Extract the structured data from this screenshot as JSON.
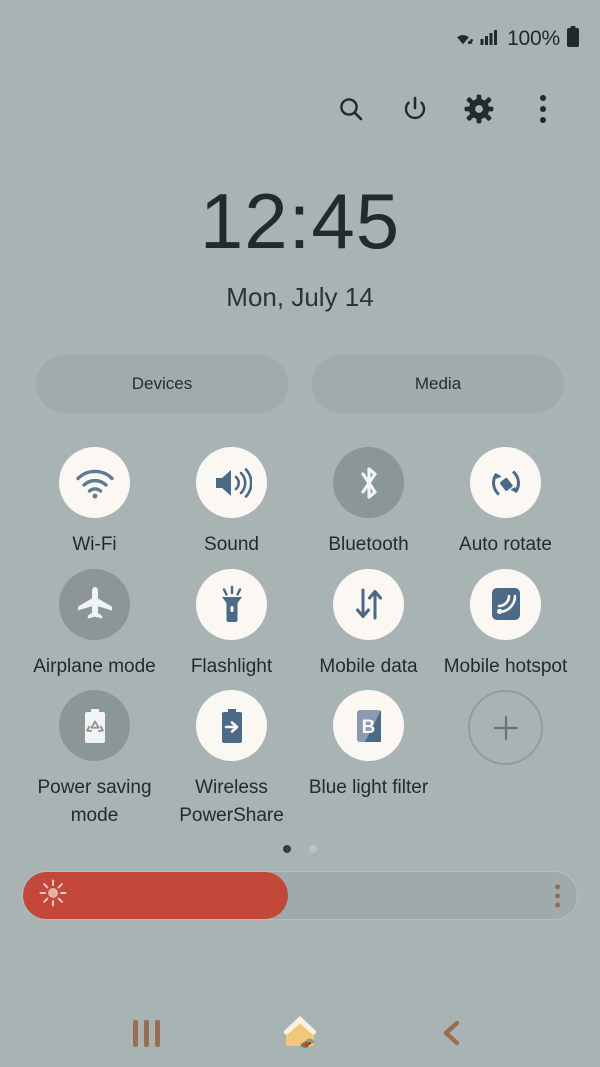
{
  "status_bar": {
    "wifi_icon": "wifi-signal-icon",
    "cellular_icon": "cellular-bars-icon",
    "battery_percent": "100%",
    "battery_icon": "battery-full-icon"
  },
  "action_bar": {
    "items": [
      {
        "name": "search-icon",
        "label": "Search"
      },
      {
        "name": "power-icon",
        "label": "Power"
      },
      {
        "name": "gear-icon",
        "label": "Settings"
      },
      {
        "name": "overflow-menu-icon",
        "label": "More options"
      }
    ]
  },
  "clock": {
    "time": "12:45",
    "date": "Mon, July 14"
  },
  "pills": [
    {
      "label": "Devices"
    },
    {
      "label": "Media"
    }
  ],
  "tiles": [
    {
      "label": "Wi-Fi",
      "icon": "wifi-icon",
      "state": "on"
    },
    {
      "label": "Sound",
      "icon": "speaker-icon",
      "state": "on"
    },
    {
      "label": "Bluetooth",
      "icon": "bluetooth-icon",
      "state": "off"
    },
    {
      "label": "Auto rotate",
      "icon": "auto-rotate-icon",
      "state": "on"
    },
    {
      "label": "Airplane mode",
      "icon": "airplane-icon",
      "state": "off"
    },
    {
      "label": "Flashlight",
      "icon": "flashlight-icon",
      "state": "on"
    },
    {
      "label": "Mobile data",
      "icon": "data-arrows-icon",
      "state": "on"
    },
    {
      "label": "Mobile hotspot",
      "icon": "hotspot-icon",
      "state": "on"
    },
    {
      "label": "Power saving mode",
      "icon": "battery-recycle-icon",
      "state": "off"
    },
    {
      "label": "Wireless PowerShare",
      "icon": "battery-share-icon",
      "state": "on"
    },
    {
      "label": "Blue light filter",
      "icon": "blue-light-b-icon",
      "state": "on"
    },
    {
      "label": "",
      "icon": "add-tile-icon",
      "state": "add"
    }
  ],
  "page_indicator": {
    "total": 2,
    "active": 1
  },
  "brightness": {
    "icon": "brightness-sun-icon",
    "value_percent": 45,
    "menu_icon": "overflow-menu-icon",
    "fill_color": "#c4483a"
  },
  "nav_bar": {
    "recents": "recents-icon",
    "home": "home-icon",
    "back": "back-icon"
  },
  "colors": {
    "background": "#a8b3b3",
    "tile_on": "#fbf7f3",
    "tile_off": "#8b9796",
    "icon_accent": "#4a6a87",
    "nav_accent": "#9a6f4e"
  }
}
